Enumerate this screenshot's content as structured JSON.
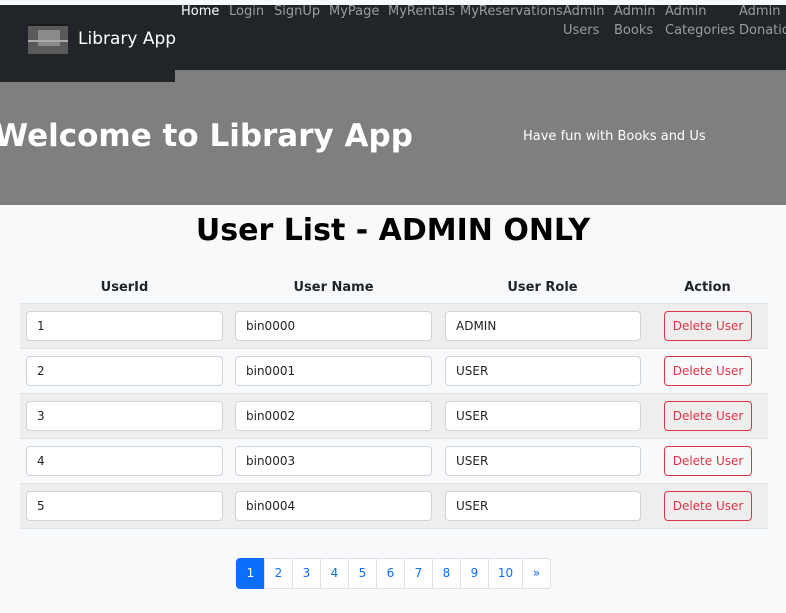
{
  "navbar": {
    "brand": "Library App",
    "links": [
      {
        "label": "Home",
        "active": true
      },
      {
        "label": "Login"
      },
      {
        "label": "SignUp"
      },
      {
        "label": "MyPage"
      },
      {
        "label": "MyRentals"
      },
      {
        "label": "MyReservations"
      },
      {
        "label": "Admin\nUsers"
      },
      {
        "label": "Admin\nBooks"
      },
      {
        "label": "Admin\nCategories"
      },
      {
        "label": "Admin\nDonations"
      }
    ]
  },
  "hero": {
    "title": "Welcome to Library App",
    "tagline": "Have fun with Books and Us"
  },
  "page": {
    "title": "User List - ADMIN ONLY"
  },
  "table": {
    "headers": [
      "UserId",
      "User Name",
      "User Role",
      "Action"
    ],
    "delete_label": "Delete User",
    "rows": [
      {
        "id": "1",
        "name": "bin0000",
        "role": "ADMIN"
      },
      {
        "id": "2",
        "name": "bin0001",
        "role": "USER"
      },
      {
        "id": "3",
        "name": "bin0002",
        "role": "USER"
      },
      {
        "id": "4",
        "name": "bin0003",
        "role": "USER"
      },
      {
        "id": "5",
        "name": "bin0004",
        "role": "USER"
      }
    ]
  },
  "pagination": {
    "pages": [
      "1",
      "2",
      "3",
      "4",
      "5",
      "6",
      "7",
      "8",
      "9",
      "10"
    ],
    "current": "1",
    "next_label": "»"
  },
  "colors": {
    "navbar_bg": "#212529",
    "hero_bg": "#7f7f7f",
    "primary": "#0d6efd",
    "danger": "#dc3545"
  }
}
